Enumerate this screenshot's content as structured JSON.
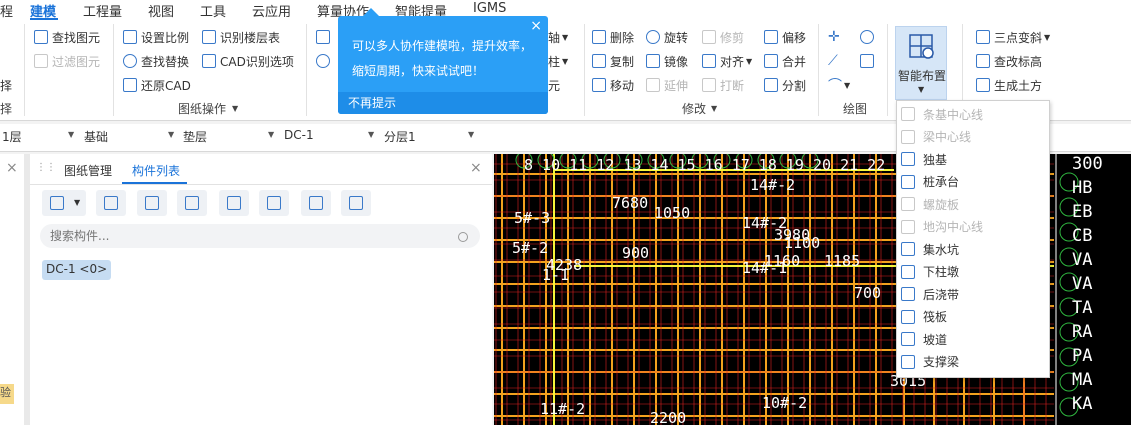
{
  "menu": {
    "items": [
      "建模",
      "工程量",
      "视图",
      "工具",
      "云应用",
      "算量协作",
      "智能提量",
      "IGMS"
    ],
    "cut_left": "程"
  },
  "ribbon": {
    "select_group": {
      "items": [
        "择",
        "择"
      ]
    },
    "drawing_ops": {
      "find_element": "查找图元",
      "filter_element": "过滤图元",
      "set_scale": "设置比例",
      "find_replace": "查找替换",
      "restore_cad": "还原CAD",
      "recognize_floor_table": "识别楼层表",
      "cad_recognize_options": "CAD识别选项",
      "label": "图纸操作"
    },
    "general_cut": {
      "axis": "轴",
      "table": "柱",
      "element": "元"
    },
    "modify": {
      "delete": "删除",
      "rotate": "旋转",
      "trim": "修剪",
      "offset": "偏移",
      "copy": "复制",
      "mirror": "镜像",
      "align": "对齐",
      "merge": "合并",
      "move": "移动",
      "extend": "延伸",
      "break": "打断",
      "split": "分割",
      "label": "修改"
    },
    "draw": {
      "label": "绘图"
    },
    "smart_layout": {
      "label": "智能布置"
    },
    "earth": {
      "three_point_slope": "三点变斜",
      "check_elevation": "查改标高",
      "gen_earthwork": "生成土方"
    }
  },
  "tooltip": {
    "text": "可以多人协作建模啦，提升效率，缩短周期，快来试试吧！",
    "close": "×",
    "no_remind": "不再提示"
  },
  "selectors": [
    {
      "value": "1层"
    },
    {
      "value": "基础"
    },
    {
      "value": "垫层"
    },
    {
      "value": "DC-1"
    },
    {
      "value": "分层1"
    }
  ],
  "panel": {
    "tabs": [
      "图纸管理",
      "构件列表"
    ],
    "search_placeholder": "搜索构件...",
    "component": "DC-1 <0>",
    "close": "×",
    "side_badge": "验"
  },
  "dropdown": {
    "items": [
      {
        "label": "条基中心线",
        "enabled": false
      },
      {
        "label": "梁中心线",
        "enabled": false
      },
      {
        "label": "独基",
        "enabled": true
      },
      {
        "label": "桩承台",
        "enabled": true
      },
      {
        "label": "螺旋板",
        "enabled": false
      },
      {
        "label": "地沟中心线",
        "enabled": false
      },
      {
        "label": "集水坑",
        "enabled": true
      },
      {
        "label": "下柱墩",
        "enabled": true
      },
      {
        "label": "后浇带",
        "enabled": true
      },
      {
        "label": "筏板",
        "enabled": true
      },
      {
        "label": "坡道",
        "enabled": true
      },
      {
        "label": "支撑梁",
        "enabled": true
      }
    ]
  },
  "cad_texts": {
    "top_numbers": "8 10 11 12 13 14 15 16 17 18 19 20 21 22",
    "right_labels": [
      "300",
      "HB",
      "EB",
      "CB",
      "VA",
      "VA",
      "TA",
      "RA",
      "PA",
      "MA",
      "KA"
    ],
    "labels": [
      "14#-2",
      "5#-3",
      "5#-2",
      "14#-2",
      "14#-1",
      "1050",
      "900",
      "700",
      "11#-2",
      "10#-2",
      "3015",
      "2200",
      "1160",
      "7680",
      "1100",
      "1185",
      "3980",
      "4238",
      "1-1"
    ]
  },
  "colors": {
    "accent": "#1a73d9",
    "tooltip": "#2b9ff6",
    "cad_bg": "#000000",
    "cad_orange": "#f2a21e",
    "cad_red": "#e02020",
    "cad_yellow": "#f5f53a",
    "cad_green": "#2fb53f"
  }
}
